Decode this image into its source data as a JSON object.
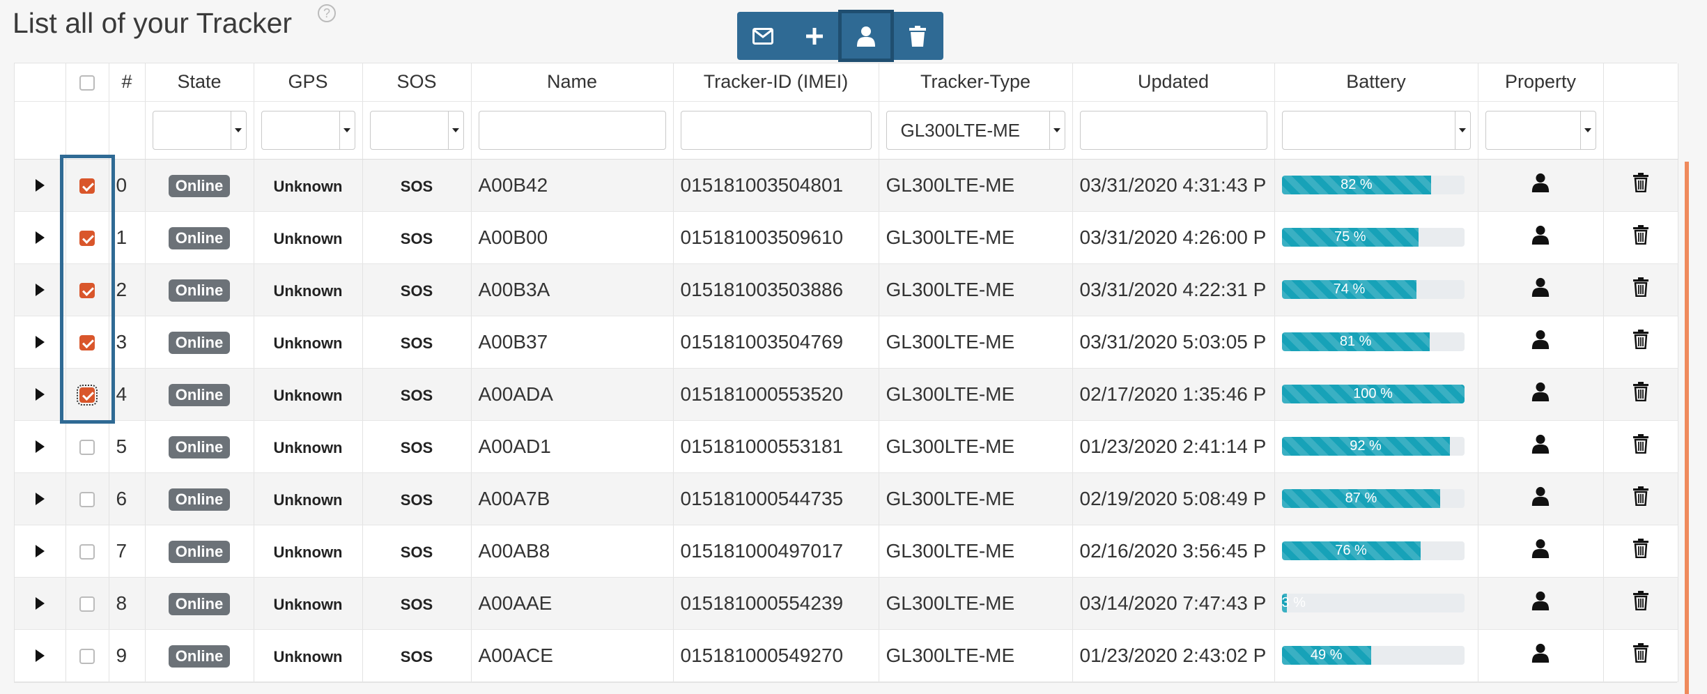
{
  "page": {
    "title": "List all of your Tracker",
    "help": "?"
  },
  "toolbar": {
    "buttons": [
      "envelope-icon",
      "plus-icon",
      "user-icon",
      "trash-icon"
    ],
    "active": "user-icon"
  },
  "colors": {
    "toolbar": "#2f6a94",
    "checked": "#d9562b",
    "battery": "#17a2b8",
    "badge": "#6c7278",
    "accent": "#ef8a5c"
  },
  "table": {
    "headers": {
      "num": "#",
      "state": "State",
      "gps": "GPS",
      "sos": "SOS",
      "name": "Name",
      "imei": "Tracker-ID (IMEI)",
      "type": "Tracker-Type",
      "updated": "Updated",
      "battery": "Battery",
      "property": "Property"
    },
    "filters": {
      "type": "GL300LTE-ME"
    },
    "rows": [
      {
        "num": "0",
        "checked": true,
        "state": "Online",
        "gps": "Unknown",
        "sos": "SOS",
        "name": "A00B42",
        "imei": "015181003504801",
        "type": "GL300LTE-ME",
        "updated": "03/31/2020 4:31:43 P",
        "battery": 82,
        "battery_label": "82 %"
      },
      {
        "num": "1",
        "checked": true,
        "state": "Online",
        "gps": "Unknown",
        "sos": "SOS",
        "name": "A00B00",
        "imei": "015181003509610",
        "type": "GL300LTE-ME",
        "updated": "03/31/2020 4:26:00 P",
        "battery": 75,
        "battery_label": "75 %"
      },
      {
        "num": "2",
        "checked": true,
        "state": "Online",
        "gps": "Unknown",
        "sos": "SOS",
        "name": "A00B3A",
        "imei": "015181003503886",
        "type": "GL300LTE-ME",
        "updated": "03/31/2020 4:22:31 P",
        "battery": 74,
        "battery_label": "74 %"
      },
      {
        "num": "3",
        "checked": true,
        "state": "Online",
        "gps": "Unknown",
        "sos": "SOS",
        "name": "A00B37",
        "imei": "015181003504769",
        "type": "GL300LTE-ME",
        "updated": "03/31/2020 5:03:05 P",
        "battery": 81,
        "battery_label": "81 %"
      },
      {
        "num": "4",
        "checked": true,
        "state": "Online",
        "gps": "Unknown",
        "sos": "SOS",
        "name": "A00ADA",
        "imei": "015181000553520",
        "type": "GL300LTE-ME",
        "updated": "02/17/2020 1:35:46 P",
        "battery": 100,
        "battery_label": "100 %"
      },
      {
        "num": "5",
        "checked": false,
        "state": "Online",
        "gps": "Unknown",
        "sos": "SOS",
        "name": "A00AD1",
        "imei": "015181000553181",
        "type": "GL300LTE-ME",
        "updated": "01/23/2020 2:41:14 P",
        "battery": 92,
        "battery_label": "92 %"
      },
      {
        "num": "6",
        "checked": false,
        "state": "Online",
        "gps": "Unknown",
        "sos": "SOS",
        "name": "A00A7B",
        "imei": "015181000544735",
        "type": "GL300LTE-ME",
        "updated": "02/19/2020 5:08:49 P",
        "battery": 87,
        "battery_label": "87 %"
      },
      {
        "num": "7",
        "checked": false,
        "state": "Online",
        "gps": "Unknown",
        "sos": "SOS",
        "name": "A00AB8",
        "imei": "015181000497017",
        "type": "GL300LTE-ME",
        "updated": "02/16/2020 3:56:45 P",
        "battery": 76,
        "battery_label": "76 %"
      },
      {
        "num": "8",
        "checked": false,
        "state": "Online",
        "gps": "Unknown",
        "sos": "SOS",
        "name": "A00AAE",
        "imei": "015181000554239",
        "type": "GL300LTE-ME",
        "updated": "03/14/2020 7:47:43 P",
        "battery": 3,
        "battery_label": "3 %"
      },
      {
        "num": "9",
        "checked": false,
        "state": "Online",
        "gps": "Unknown",
        "sos": "SOS",
        "name": "A00ACE",
        "imei": "015181000549270",
        "type": "GL300LTE-ME",
        "updated": "01/23/2020 2:43:02 P",
        "battery": 49,
        "battery_label": "49 %"
      }
    ]
  }
}
